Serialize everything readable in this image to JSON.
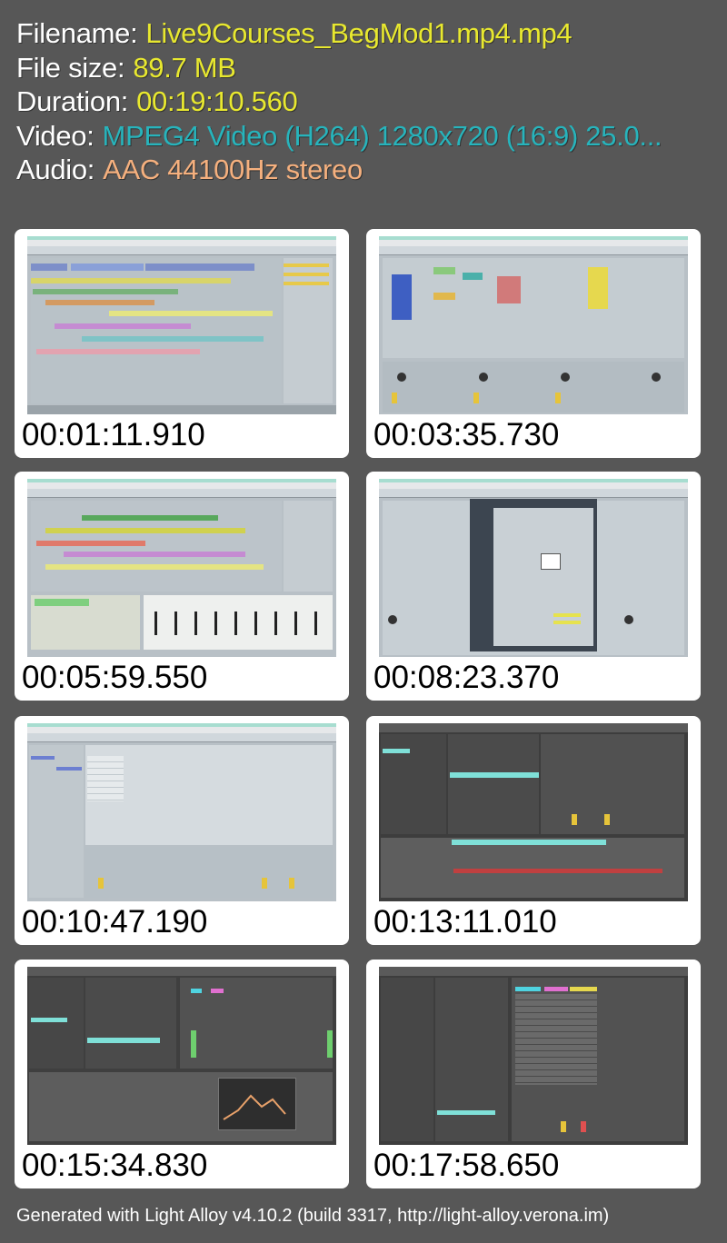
{
  "header": {
    "filename": {
      "label": "Filename:",
      "value": "Live9Courses_BegMod1.mp4.mp4",
      "color": "#e8e82f"
    },
    "filesize": {
      "label": "File size:",
      "value": "89.7 MB",
      "color": "#e8e82f"
    },
    "duration": {
      "label": "Duration:",
      "value": "00:19:10.560",
      "color": "#e8e82f"
    },
    "video": {
      "label": "Video:",
      "value": "MPEG4 Video (H264) 1280x720 (16:9) 25.0...",
      "color": "#27b4bc"
    },
    "audio": {
      "label": "Audio:",
      "value": "AAC 44100Hz stereo",
      "color": "#f5b07e"
    }
  },
  "thumbnails": [
    {
      "timestamp": "00:01:11.910",
      "view": "arrangement"
    },
    {
      "timestamp": "00:03:35.730",
      "view": "session"
    },
    {
      "timestamp": "00:05:59.550",
      "view": "arrangement-detail"
    },
    {
      "timestamp": "00:08:23.370",
      "view": "preferences"
    },
    {
      "timestamp": "00:10:47.190",
      "view": "session-browser"
    },
    {
      "timestamp": "00:13:11.010",
      "view": "session-dark-synth"
    },
    {
      "timestamp": "00:15:34.830",
      "view": "session-dark-wave"
    },
    {
      "timestamp": "00:17:58.650",
      "view": "session-dark-list"
    }
  ],
  "footer": "Generated with Light Alloy v4.10.2 (build 3317, http://light-alloy.verona.im)"
}
